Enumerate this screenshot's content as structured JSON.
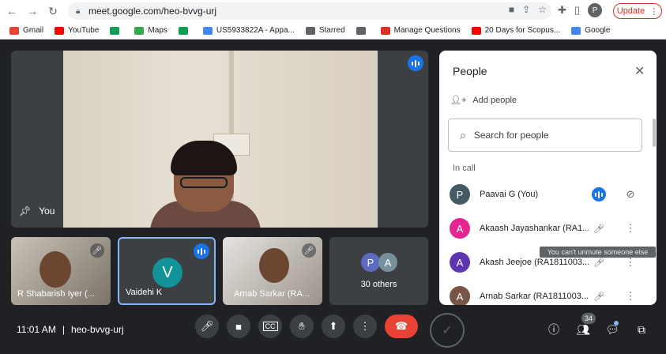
{
  "browser": {
    "url": "meet.google.com/heo-bvvg-urj",
    "profile_initial": "P",
    "update_label": "Update"
  },
  "bookmarks": [
    {
      "label": "Gmail",
      "color": "#ea4335"
    },
    {
      "label": "YouTube",
      "color": "#ff0000"
    },
    {
      "label": "",
      "color": "#0f9d58"
    },
    {
      "label": "Maps",
      "color": "#34a853"
    },
    {
      "label": "",
      "color": "#0f9d58"
    },
    {
      "label": "US5933822A - Appa...",
      "color": "#4285f4"
    },
    {
      "label": "Starred",
      "color": "#5f6368"
    },
    {
      "label": "",
      "color": "#5f6368"
    },
    {
      "label": "Manage Questions",
      "color": "#d93025"
    },
    {
      "label": "20 Days for Scopus...",
      "color": "#ff0000"
    },
    {
      "label": "Google",
      "color": "#4285f4"
    }
  ],
  "main_tile": {
    "label": "You"
  },
  "tiles": [
    {
      "name": "R Shabarish Iyer (..."
    },
    {
      "name": "Vaidehi K",
      "initial": "V"
    },
    {
      "name": "Arnab Sarkar (RA..."
    },
    {
      "name": "30 others",
      "initials": [
        "P",
        "A"
      ]
    }
  ],
  "panel": {
    "title": "People",
    "add_people": "Add people",
    "search_placeholder": "Search for people",
    "section": "In call",
    "participants": [
      {
        "initial": "P",
        "name": "Paavai G (You)",
        "color": "#455a64"
      },
      {
        "initial": "A",
        "name": "Akaash Jayashankar (RA1...",
        "color": "#e52592"
      },
      {
        "initial": "A",
        "name": "Akash Jeejoe (RA1811003...",
        "color": "#5e35b1"
      },
      {
        "initial": "A",
        "name": "Arnab Sarkar (RA1811003...",
        "color": "#795548"
      }
    ],
    "tooltip": "You can't unmute someone else"
  },
  "footer": {
    "time": "11:01 AM",
    "meeting_code": "heo-bvvg-urj",
    "participant_count": "34"
  }
}
